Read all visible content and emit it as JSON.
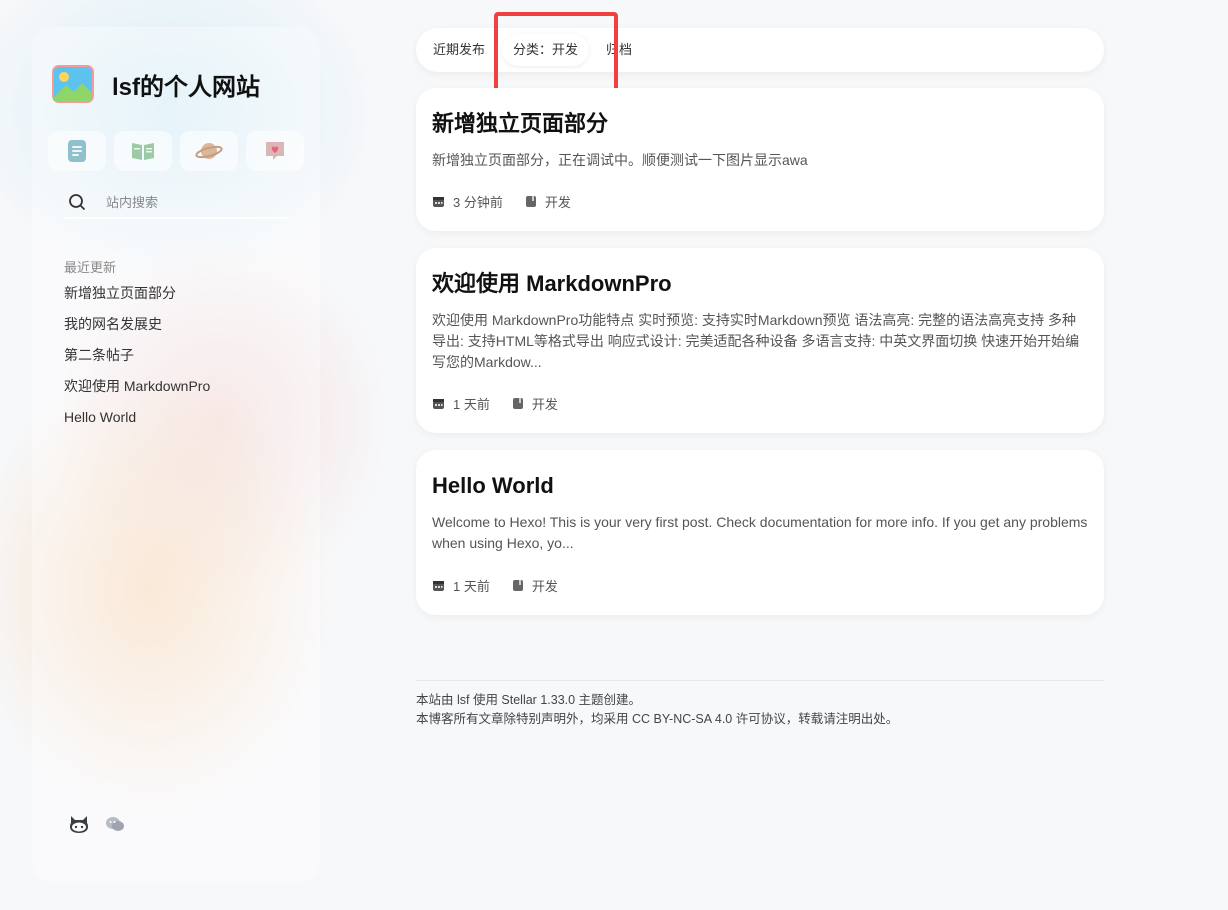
{
  "site": {
    "title": "lsf的个人网站"
  },
  "sidebar": {
    "nav_icons": [
      "document-icon",
      "book-icon",
      "planet-icon",
      "heart-icon"
    ],
    "search": {
      "placeholder": "站内搜索"
    },
    "recent": {
      "label": "最近更新",
      "items": [
        "新增独立页面部分",
        "我的网名发展史",
        "第二条帖子",
        "欢迎使用 MarkdownPro",
        "Hello World"
      ]
    },
    "social_icons": [
      "github-icon",
      "chat-icon"
    ]
  },
  "nav": {
    "tabs": [
      "近期发布",
      "分类：开发",
      "归档"
    ],
    "active_index": 1
  },
  "posts": [
    {
      "title": "新增独立页面部分",
      "excerpt": "新增独立页面部分，正在调试中。顺便测试一下图片显示awa",
      "time": "3 分钟前",
      "category": "开发"
    },
    {
      "title": "欢迎使用 MarkdownPro",
      "excerpt": "欢迎使用 MarkdownPro功能特点 实时预览: 支持实时Markdown预览 语法高亮: 完整的语法高亮支持 多种导出: 支持HTML等格式导出 响应式设计: 完美适配各种设备 多语言支持: 中英文界面切换 快速开始开始编写您的Markdow...",
      "time": "1 天前",
      "category": "开发"
    },
    {
      "title": "Hello World",
      "excerpt": "Welcome to Hexo! This is your very first post. Check documentation for more info. If you get any problems when using Hexo, yo...",
      "time": "1 天前",
      "category": "开发"
    }
  ],
  "footer": {
    "line1": "本站由 lsf 使用 Stellar 1.33.0 主题创建。",
    "line2": "本博客所有文章除特别声明外，均采用 CC BY-NC-SA 4.0 许可协议，转载请注明出处。"
  },
  "colors": {
    "highlight": "#f04040"
  }
}
